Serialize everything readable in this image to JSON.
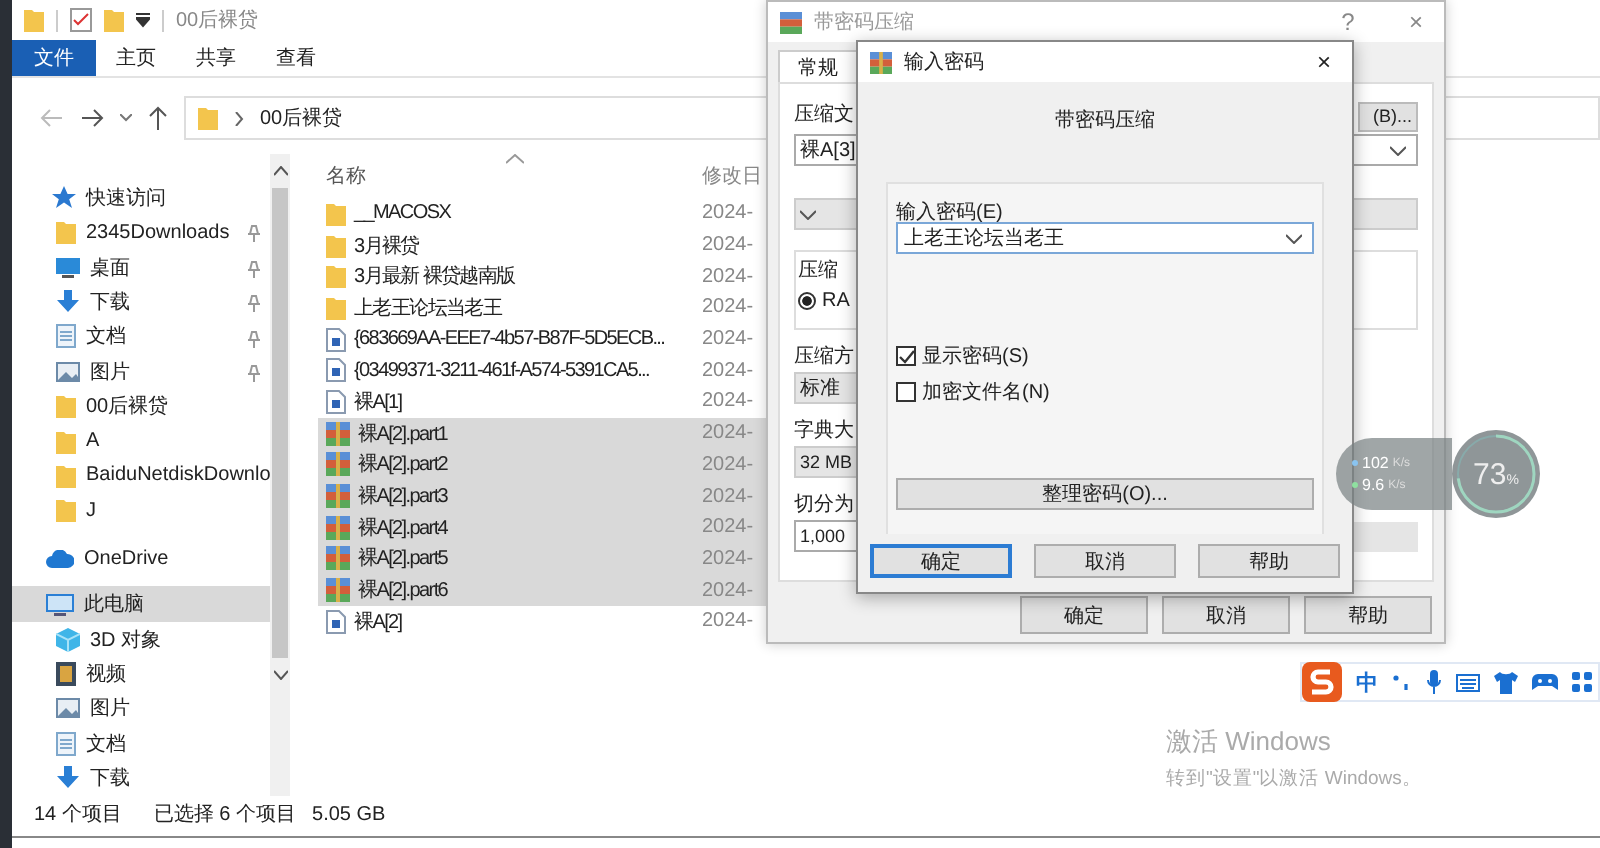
{
  "explorer": {
    "title": "00后裸贷",
    "ribbon_tabs": [
      {
        "label": "文件",
        "selected": true
      },
      {
        "label": "主页",
        "selected": false
      },
      {
        "label": "共享",
        "selected": false
      },
      {
        "label": "查看",
        "selected": false
      }
    ],
    "address": "00后裸贷",
    "nav": [
      {
        "label": "快速访问",
        "kind": "star",
        "pinned": false,
        "selected": false
      },
      {
        "label": "2345Downloads",
        "kind": "folder",
        "pinned": true,
        "selected": false
      },
      {
        "label": "桌面",
        "kind": "desktop",
        "pinned": true,
        "selected": false
      },
      {
        "label": "下载",
        "kind": "download",
        "pinned": true,
        "selected": false
      },
      {
        "label": "文档",
        "kind": "document",
        "pinned": true,
        "selected": false
      },
      {
        "label": "图片",
        "kind": "picture",
        "pinned": true,
        "selected": false
      },
      {
        "label": "00后裸贷",
        "kind": "folder",
        "pinned": false,
        "selected": false
      },
      {
        "label": "A",
        "kind": "folder",
        "pinned": false,
        "selected": false
      },
      {
        "label": "BaiduNetdiskDownlo",
        "kind": "folder",
        "pinned": false,
        "selected": false
      },
      {
        "label": "J",
        "kind": "folder",
        "pinned": false,
        "selected": false
      },
      {
        "label": "OneDrive",
        "kind": "cloud",
        "pinned": false,
        "selected": false
      },
      {
        "label": "此电脑",
        "kind": "pc",
        "pinned": false,
        "selected": true
      },
      {
        "label": "3D 对象",
        "kind": "cube",
        "pinned": false,
        "selected": false
      },
      {
        "label": "视频",
        "kind": "video",
        "pinned": false,
        "selected": false
      },
      {
        "label": "图片",
        "kind": "picture",
        "pinned": false,
        "selected": false
      },
      {
        "label": "文档",
        "kind": "document",
        "pinned": false,
        "selected": false
      },
      {
        "label": "下载",
        "kind": "download",
        "pinned": false,
        "selected": false
      }
    ],
    "columns": [
      "名称",
      "修改日"
    ],
    "files": [
      {
        "name": "__MACOSX",
        "kind": "folder",
        "date": "2024-",
        "selected": false
      },
      {
        "name": "3月裸贷",
        "kind": "folder",
        "date": "2024-",
        "selected": false
      },
      {
        "name": "3月最新 裸贷越南版",
        "kind": "folder",
        "date": "2024-",
        "selected": false
      },
      {
        "name": "上老王论坛当老王",
        "kind": "folder",
        "date": "2024-",
        "selected": false
      },
      {
        "name": "{683669AA-EEE7-4b57-B87F-5D5ECB...",
        "kind": "file",
        "date": "2024-",
        "selected": false
      },
      {
        "name": "{03499371-3211-461f-A574-5391CA5...",
        "kind": "file",
        "date": "2024-",
        "selected": false
      },
      {
        "name": "裸A[1]",
        "kind": "file",
        "date": "2024-",
        "selected": false
      },
      {
        "name": "裸A[2].part1",
        "kind": "archive",
        "date": "2024-",
        "selected": true
      },
      {
        "name": "裸A[2].part2",
        "kind": "archive",
        "date": "2024-",
        "selected": true
      },
      {
        "name": "裸A[2].part3",
        "kind": "archive",
        "date": "2024-",
        "selected": true
      },
      {
        "name": "裸A[2].part4",
        "kind": "archive",
        "date": "2024-",
        "selected": true
      },
      {
        "name": "裸A[2].part5",
        "kind": "archive",
        "date": "2024-",
        "selected": true
      },
      {
        "name": "裸A[2].part6",
        "kind": "archive",
        "date": "2024-",
        "selected": true
      },
      {
        "name": "裸A[2]",
        "kind": "file",
        "date": "2024-",
        "selected": false
      }
    ],
    "status": [
      "14 个项目",
      "已选择 6 个项目",
      "5.05 GB"
    ]
  },
  "compress_dialog": {
    "title": "带密码压缩",
    "help": "?",
    "close": "×",
    "tabs": [
      {
        "label": "常规",
        "selected": true
      }
    ],
    "archive_label": "压缩文",
    "browse_button": "(B)...",
    "archive_name": "裸A[3]",
    "group_label": "压缩",
    "radio": {
      "label": "RA",
      "selected": true
    },
    "method_label": "压缩方",
    "method_value": "标准",
    "dict_label": "字典大",
    "dict_value": "32 MB",
    "split_label": "切分为",
    "split_value": "1,000",
    "buttons": [
      "确定",
      "取消",
      "帮助"
    ]
  },
  "password_dialog": {
    "title": "输入密码",
    "close": "×",
    "heading": "带密码压缩",
    "field_label": "输入密码(E)",
    "password": "上老王论坛当老王",
    "checkboxes": [
      {
        "label": "显示密码(S)",
        "checked": true
      },
      {
        "label": "加密文件名(N)",
        "checked": false
      }
    ],
    "manage_button": "整理密码(O)...",
    "buttons": [
      {
        "label": "确定",
        "selected": true
      },
      {
        "label": "取消",
        "selected": false
      },
      {
        "label": "帮助",
        "selected": false
      }
    ]
  },
  "speed_widget": {
    "upload": "102",
    "upload_unit": "K/s",
    "download": "9.6",
    "download_unit": "K/s",
    "percent": "73",
    "percent_unit": "%",
    "level": 0.73
  },
  "ime_bar": {
    "mode": "中"
  },
  "activation": {
    "title": "激活 Windows",
    "text": "转到\"设置\"以激活 Windows。"
  }
}
